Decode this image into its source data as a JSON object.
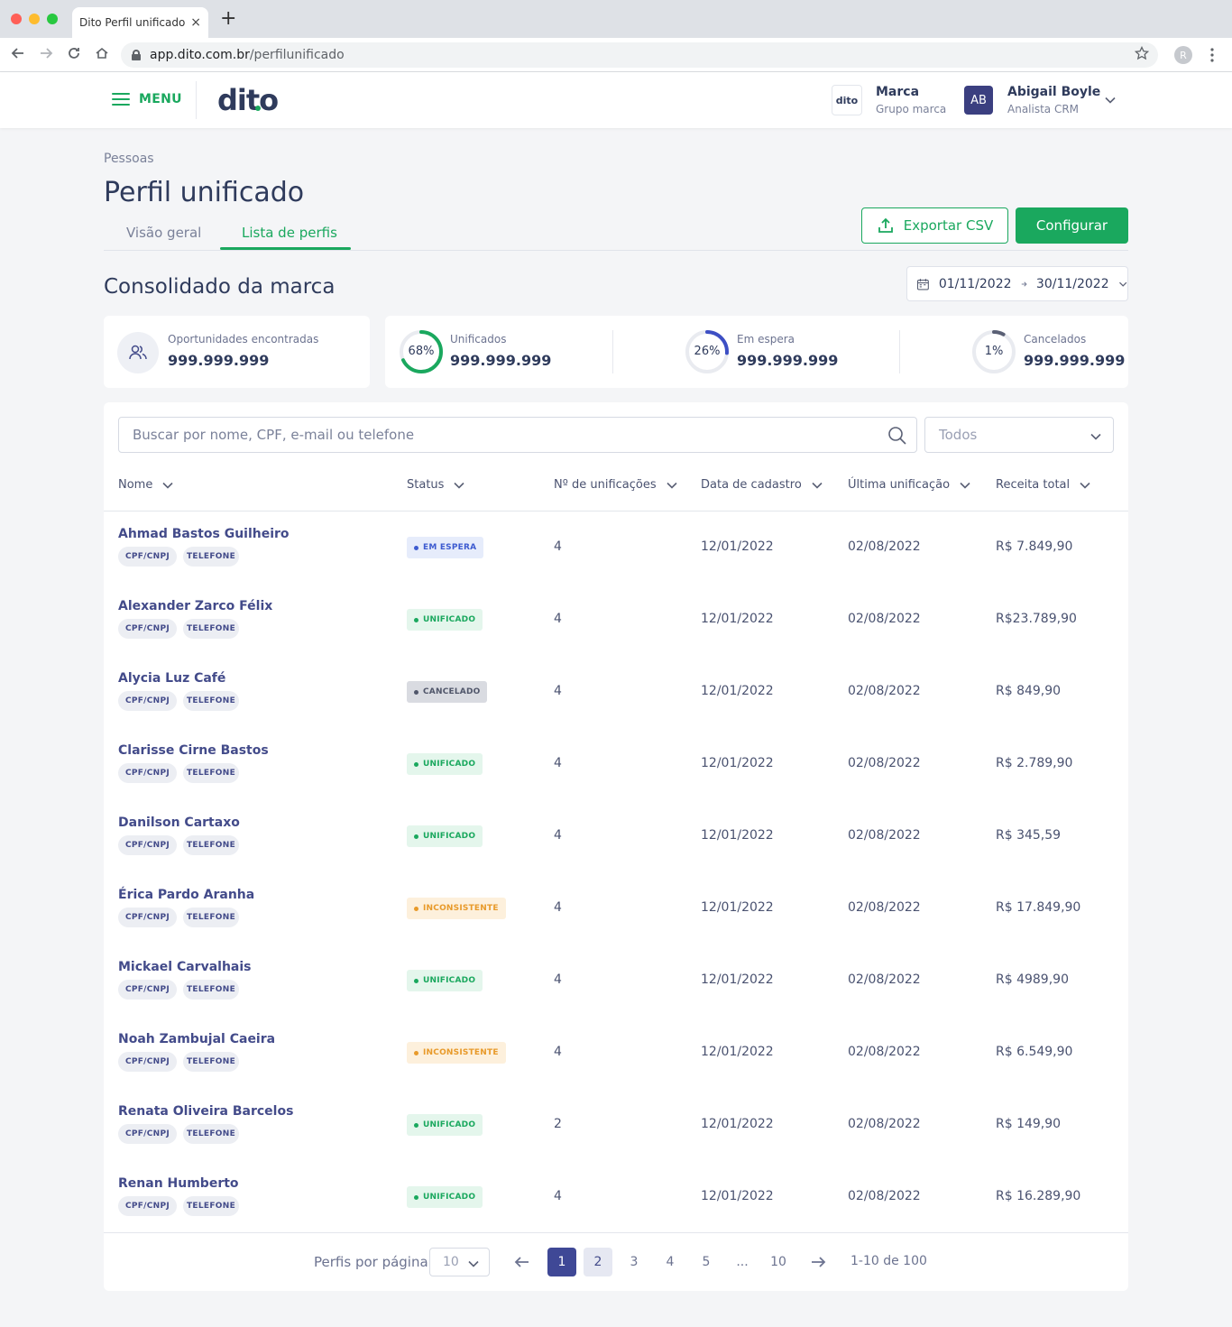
{
  "browser": {
    "tab_title": "Dito Perfil unificado",
    "tab_close": "×",
    "new_tab": "+",
    "url_host": "app.dito.com.br",
    "url_path": "/perfilunificado",
    "profile_initial": "R"
  },
  "header": {
    "menu_label": "MENU",
    "logo_text": "dito",
    "brand_logo_text": "dito",
    "brand_name": "Marca",
    "brand_group": "Grupo marca",
    "user_initials": "AB",
    "user_name": "Abigail Boyle",
    "user_role": "Analista CRM"
  },
  "page": {
    "breadcrumb": "Pessoas",
    "title": "Perfil unificado",
    "tabs": [
      {
        "label": "Visão geral",
        "active": false
      },
      {
        "label": "Lista de perfis",
        "active": true
      }
    ],
    "export_label": "Exportar CSV",
    "config_label": "Configurar",
    "section_title": "Consolidado da marca",
    "date_start": "01/11/2022",
    "date_end": "30/11/2022"
  },
  "stats": {
    "opportunities": {
      "label": "Oportunidades encontradas",
      "value": "999.999.999"
    },
    "unified": {
      "label": "Unificados",
      "value": "999.999.999",
      "percent_text": "68%",
      "percent": 68,
      "color": "#1aa85e"
    },
    "waiting": {
      "label": "Em espera",
      "value": "999.999.999",
      "percent_text": "26%",
      "percent": 26,
      "color": "#3d4fc4"
    },
    "canceled": {
      "label": "Cancelados",
      "value": "999.999.999",
      "percent_text": "1%",
      "percent": 1,
      "color": "#5a6075"
    }
  },
  "table": {
    "search_placeholder": "Buscar por nome, CPF, e-mail ou telefone",
    "filter_value": "Todos",
    "columns": [
      "Nome",
      "Status",
      "Nº de unificações",
      "Data de cadastro",
      "Última unificação",
      "Receita total"
    ],
    "chip_labels": [
      "CPF/CNPJ",
      "TELEFONE"
    ],
    "rows": [
      {
        "name": "Ahmad Bastos Guilheiro",
        "status": "EM ESPERA",
        "status_type": "espera",
        "unifications": "4",
        "created": "12/01/2022",
        "last": "02/08/2022",
        "revenue": "R$ 7.849,90"
      },
      {
        "name": "Alexander Zarco Félix",
        "status": "UNIFICADO",
        "status_type": "unificado",
        "unifications": "4",
        "created": "12/01/2022",
        "last": "02/08/2022",
        "revenue": "R$23.789,90"
      },
      {
        "name": "Alycia Luz Café",
        "status": "CANCELADO",
        "status_type": "cancelado",
        "unifications": "4",
        "created": "12/01/2022",
        "last": "02/08/2022",
        "revenue": "R$ 849,90"
      },
      {
        "name": "Clarisse Cirne Bastos",
        "status": "UNIFICADO",
        "status_type": "unificado",
        "unifications": "4",
        "created": "12/01/2022",
        "last": "02/08/2022",
        "revenue": "R$ 2.789,90"
      },
      {
        "name": "Danilson Cartaxo",
        "status": "UNIFICADO",
        "status_type": "unificado",
        "unifications": "4",
        "created": "12/01/2022",
        "last": "02/08/2022",
        "revenue": "R$ 345,59"
      },
      {
        "name": "Érica Pardo Aranha",
        "status": "INCONSISTENTE",
        "status_type": "inconsistente",
        "unifications": "4",
        "created": "12/01/2022",
        "last": "02/08/2022",
        "revenue": "R$ 17.849,90"
      },
      {
        "name": "Mickael Carvalhais",
        "status": "UNIFICADO",
        "status_type": "unificado",
        "unifications": "4",
        "created": "12/01/2022",
        "last": "02/08/2022",
        "revenue": "R$ 4989,90"
      },
      {
        "name": "Noah Zambujal Caeira",
        "status": "INCONSISTENTE",
        "status_type": "inconsistente",
        "unifications": "4",
        "created": "12/01/2022",
        "last": "02/08/2022",
        "revenue": "R$ 6.549,90"
      },
      {
        "name": "Renata Oliveira Barcelos",
        "status": "UNIFICADO",
        "status_type": "unificado",
        "unifications": "2",
        "created": "12/01/2022",
        "last": "02/08/2022",
        "revenue": "R$ 149,90"
      },
      {
        "name": "Renan Humberto",
        "status": "UNIFICADO",
        "status_type": "unificado",
        "unifications": "4",
        "created": "12/01/2022",
        "last": "02/08/2022",
        "revenue": "R$ 16.289,90"
      }
    ]
  },
  "pagination": {
    "per_page_label": "Perfis por página",
    "per_page_value": "10",
    "pages": [
      "1",
      "2",
      "3",
      "4",
      "5",
      "...",
      "10"
    ],
    "current": "1",
    "range_text": "1-10 de 100"
  }
}
